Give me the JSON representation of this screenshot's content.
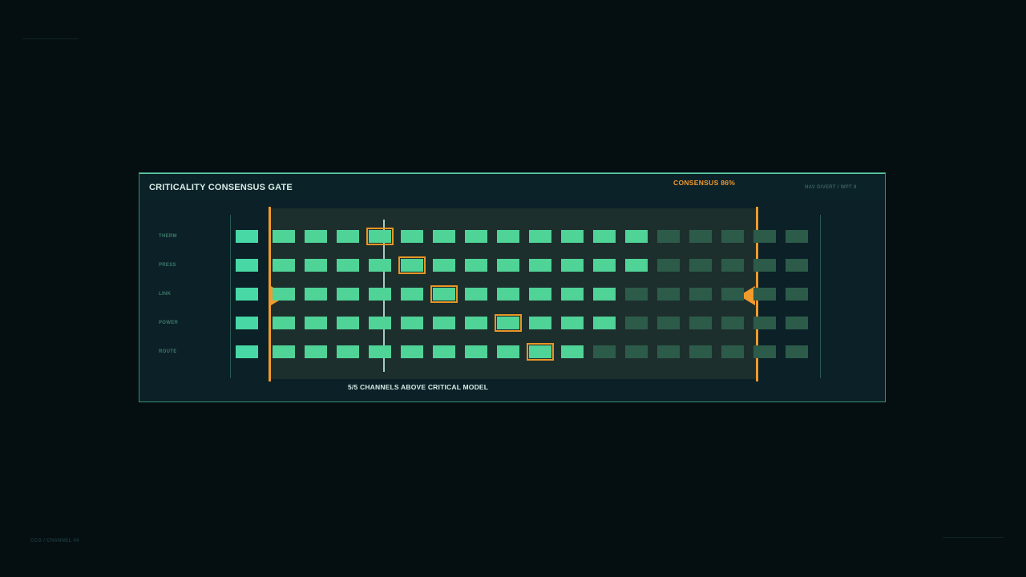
{
  "panel": {
    "title": "CRITICALITY CONSENSUS GATE",
    "consensus_label": "CONSENSUS 86%",
    "consensus_percent": 86,
    "route_info": "NAV DIVERT / WPT 8",
    "status": "5/5 CHANNELS ABOVE CRITICAL MODEL"
  },
  "footer": {
    "code": "CCG / CHANNEL 04"
  },
  "grid": {
    "columns": 18,
    "rows": [
      {
        "label": "THERM",
        "active_count": 13,
        "highlight_index": 4
      },
      {
        "label": "PRESS",
        "active_count": 13,
        "highlight_index": 5
      },
      {
        "label": "LINK",
        "active_count": 12,
        "highlight_index": 6
      },
      {
        "label": "POWER",
        "active_count": 12,
        "highlight_index": 8
      },
      {
        "label": "ROUTE",
        "active_count": 11,
        "highlight_index": 9
      }
    ]
  },
  "colors": {
    "accent": "#f29a2c",
    "cell_active": "#4fd397",
    "cell_dim": "#2c5b4a",
    "panel_border": "#3a8e73",
    "background": "#050f11"
  }
}
